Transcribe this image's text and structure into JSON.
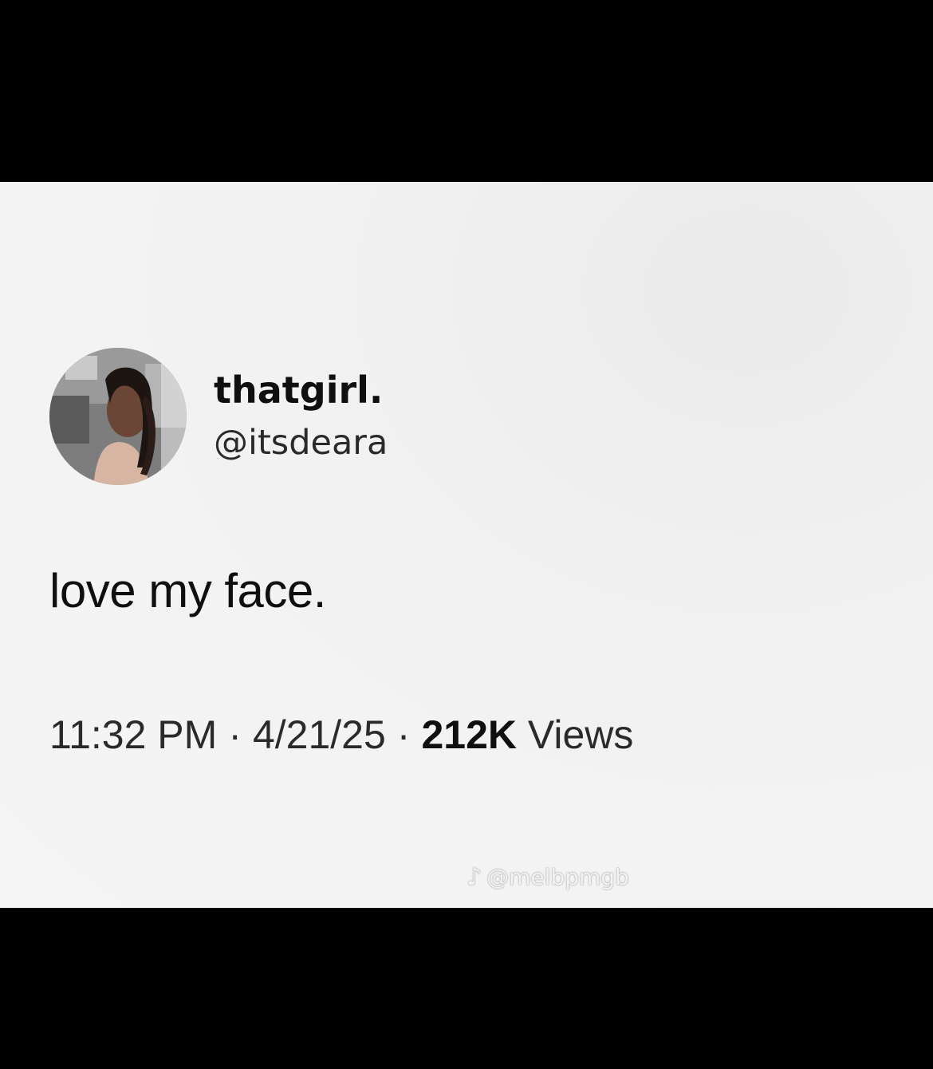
{
  "tweet": {
    "display_name": "thatgirl.",
    "handle": "@itsdeara",
    "text": "love my face.",
    "time": "11:32 PM",
    "date": "4/21/25",
    "views_count": "212K",
    "views_label": "Views",
    "separator": "·"
  },
  "watermark": {
    "icon": "tiktok-icon",
    "text": "@melbpmgb"
  },
  "colors": {
    "background": "#000000",
    "card": "#f3f3f3",
    "text": "#0f0f0f"
  }
}
